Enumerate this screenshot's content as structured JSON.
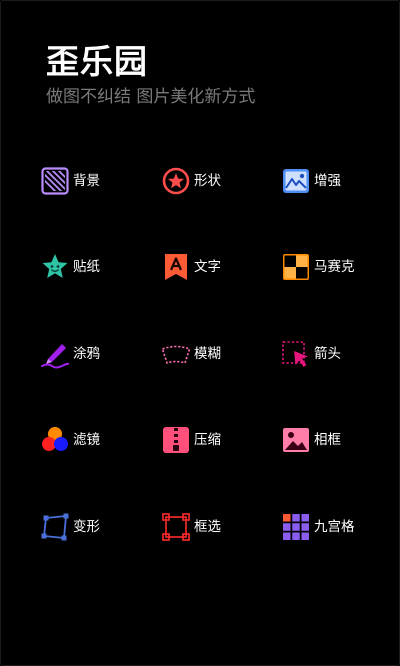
{
  "app": {
    "title": "歪乐园",
    "subtitle": "做图不纠结 图片美化新方式"
  },
  "colors": {
    "background": "#000000",
    "subtitle": "#7a7a7a"
  },
  "tools": [
    {
      "label": "背景",
      "icon": "background-icon",
      "color": "#b98cff"
    },
    {
      "label": "形状",
      "icon": "star-circle-icon",
      "color": "#ff4d4d"
    },
    {
      "label": "增强",
      "icon": "enhance-image-icon",
      "color": "#4f8ef7"
    },
    {
      "label": "贴纸",
      "icon": "star-sticker-icon",
      "color": "#2ec4a5"
    },
    {
      "label": "文字",
      "icon": "text-bookmark-icon",
      "color": "#ff5a36"
    },
    {
      "label": "马赛克",
      "icon": "mosaic-icon",
      "color": "#ff8a00"
    },
    {
      "label": "涂鸦",
      "icon": "pen-doodle-icon",
      "color": "#a020f0"
    },
    {
      "label": "模糊",
      "icon": "blur-fan-icon",
      "color": "#ff6fb5"
    },
    {
      "label": "箭头",
      "icon": "arrow-cursor-icon",
      "color": "#e6157b"
    },
    {
      "label": "滤镜",
      "icon": "filter-circles-icon",
      "color": "#ff3d3d"
    },
    {
      "label": "压缩",
      "icon": "zip-icon",
      "color": "#ff4f7b"
    },
    {
      "label": "相框",
      "icon": "photo-frame-icon",
      "color": "#ff7ea8"
    },
    {
      "label": "变形",
      "icon": "transform-icon",
      "color": "#4a6fd8"
    },
    {
      "label": "框选",
      "icon": "select-box-icon",
      "color": "#ff2b2b"
    },
    {
      "label": "九宫格",
      "icon": "nine-grid-icon",
      "color": "#8a5cf0"
    }
  ]
}
